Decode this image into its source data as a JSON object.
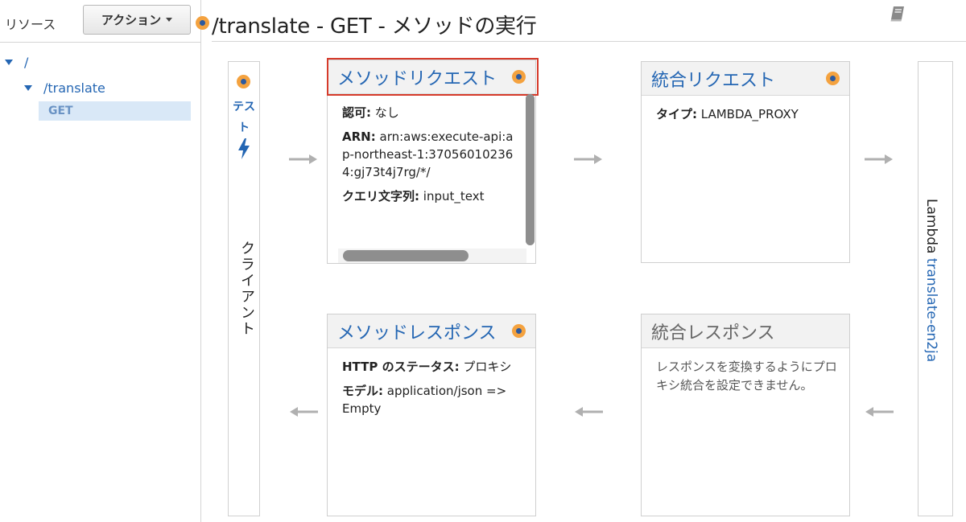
{
  "sidebar": {
    "resources_label": "リソース",
    "actions_label": "アクション",
    "tree": {
      "root": "/",
      "translate": "/translate",
      "get": "GET"
    }
  },
  "header": {
    "title": "/translate - GET - メソッドの実行"
  },
  "client": {
    "test_label": "テスト",
    "label": "クライアント"
  },
  "lambda": {
    "prefix": "Lambda",
    "function": "translate-en2ja"
  },
  "method_request": {
    "title": "メソッドリクエスト",
    "auth_label": "認可:",
    "auth_value": "なし",
    "arn_label": "ARN:",
    "arn_value": "arn:aws:execute-api:ap-northeast-1:370560102364:gj73t4j7rg/*/",
    "query_label": "クエリ文字列:",
    "query_value": "input_text"
  },
  "integration_request": {
    "title": "統合リクエスト",
    "type_label": "タイプ:",
    "type_value": "LAMBDA_PROXY"
  },
  "method_response": {
    "title": "メソッドレスポンス",
    "status_label": "HTTP のステータス:",
    "status_value": "プロキシ",
    "model_label": "モデル:",
    "model_value": "application/json => Empty"
  },
  "integration_response": {
    "title": "統合レスポンス",
    "message": "レスポンスを変換するようにプロキシ統合を設定できません。"
  },
  "colors": {
    "link_blue": "#2466b3",
    "highlight_red": "#d63a2a",
    "dot_orange": "#f4a23f",
    "arrow_gray": "#b0b0b0"
  }
}
